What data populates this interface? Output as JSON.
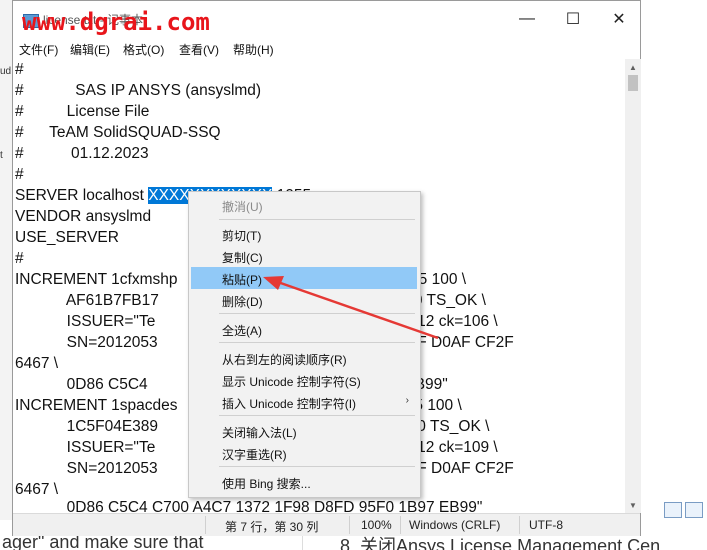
{
  "watermark": "www.dgrai.com",
  "window": {
    "title": "license.txt - 记事本",
    "controls": {
      "minimize": "—",
      "maximize": "☐",
      "close": "✕"
    }
  },
  "menu": [
    "文件(F)",
    "编辑(E)",
    "格式(O)",
    "查看(V)",
    "帮助(H)"
  ],
  "editor": {
    "lines": [
      "#",
      "#            SAS IP ANSYS (ansyslmd)",
      "#          License File",
      "#      TeAM SolidSQUAD-SSQ",
      "#           01.12.2023",
      "#",
      "SERVER localhost ",
      "VENDOR ansyslmd",
      "USE_SERVER",
      "#",
      "INCREMENT 1cfxmshp                                                  2035 100 \\",
      "            AF61B7FB17                                           r:20120530 TS_OK \\",
      "            ISSUER=\"Te                                            12-Dec-2012 ck=106 \\",
      "            SN=2012053                                            \"0000 678F D0AF CF2F",
      "6467 \\",
      "            0D86 C5C4                                             F0 1B97 EB99\"",
      "INCREMENT 1spacdes                                                 2035 100 \\",
      "            1C5F04E389                                            r:20120530 TS_OK \\",
      "            ISSUER=\"Te                                            12-Dec-2012 ck=109 \\",
      "            SN=2012053                                            \"0000 678F D0AF CF2F",
      "6467 \\",
      "            0D86 C5C4 C700 A4C7 1372 1F98 D8FD 95F0 1B97 EB99\""
    ],
    "selected_text": "XXXXXXXXXXXX",
    "after_selection": " 1055"
  },
  "statusbar": {
    "position": "第 7 行，第 30 列",
    "zoom": "100%",
    "line_ending": "Windows (CRLF)",
    "encoding": "UTF-8"
  },
  "context_menu": {
    "items": [
      {
        "label": "撤消(U)",
        "disabled": true
      },
      {
        "label": "剪切(T)"
      },
      {
        "label": "复制(C)"
      },
      {
        "label": "粘贴(P)",
        "highlighted": true
      },
      {
        "label": "删除(D)"
      },
      {
        "label": "全选(A)"
      },
      {
        "label": "从右到左的阅读顺序(R)"
      },
      {
        "label": "显示 Unicode 控制字符(S)"
      },
      {
        "label": "插入 Unicode 控制字符(I)",
        "submenu": true
      },
      {
        "label": "关闭输入法(L)"
      },
      {
        "label": "汉字重选(R)"
      },
      {
        "label": "使用 Bing 搜索..."
      }
    ]
  },
  "background_text": {
    "bottom_left": "ager\" and make sure that",
    "bottom_right": "8. 关闭Ansys License Management Cen"
  },
  "colors": {
    "annotation_arrow": "#e53935",
    "selection": "#0078d7",
    "menu_highlight": "#91c9f7"
  }
}
